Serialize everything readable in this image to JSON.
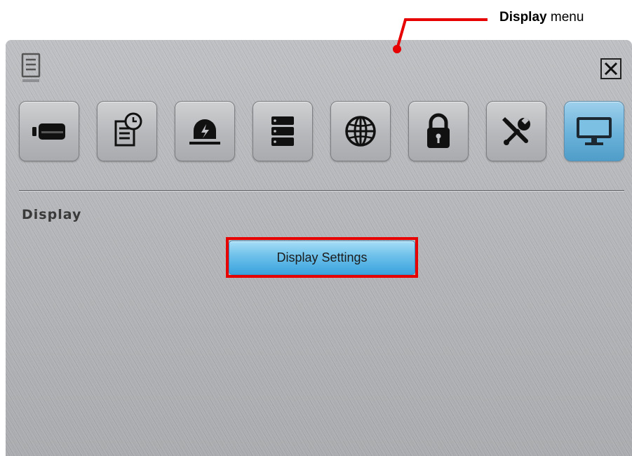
{
  "annotation": {
    "bold_label": "Display",
    "label_suffix": " menu",
    "color": "#e60000"
  },
  "window": {
    "doc_icon": "document-list-icon",
    "close_icon": "close-x-icon"
  },
  "toolbar": {
    "items": [
      {
        "icon": "camera-icon",
        "active": false
      },
      {
        "icon": "record-schedule-icon",
        "active": false
      },
      {
        "icon": "alarm-light-icon",
        "active": false
      },
      {
        "icon": "storage-icon",
        "active": false
      },
      {
        "icon": "network-globe-icon",
        "active": false
      },
      {
        "icon": "lock-icon",
        "active": false
      },
      {
        "icon": "tools-icon",
        "active": false
      },
      {
        "icon": "monitor-icon",
        "active": true
      }
    ],
    "active_color": "#6ab2da"
  },
  "section": {
    "title": "Display"
  },
  "buttons": {
    "display_settings": "Display Settings"
  }
}
